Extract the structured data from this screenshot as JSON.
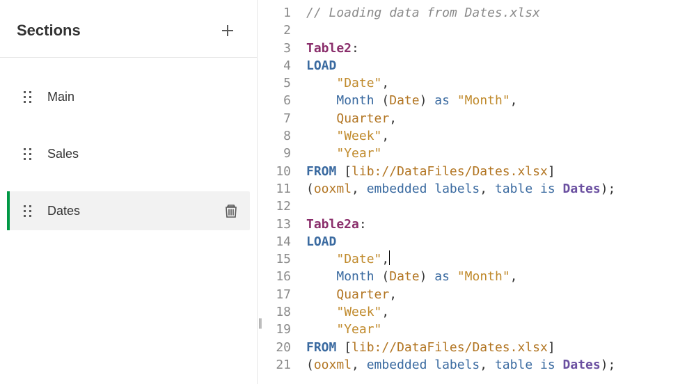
{
  "sidebar": {
    "title": "Sections",
    "items": [
      {
        "label": "Main",
        "active": false
      },
      {
        "label": "Sales",
        "active": false
      },
      {
        "label": "Dates",
        "active": true
      }
    ]
  },
  "editor": {
    "lines": [
      {
        "n": 1,
        "t": [
          {
            "c": "tok-comment",
            "v": "// Loading data from Dates.xlsx"
          }
        ]
      },
      {
        "n": 2,
        "t": []
      },
      {
        "n": 3,
        "t": [
          {
            "c": "tok-label",
            "v": "Table2"
          },
          {
            "c": "tok-plain",
            "v": ":"
          }
        ]
      },
      {
        "n": 4,
        "t": [
          {
            "c": "tok-kw",
            "v": "LOAD"
          }
        ]
      },
      {
        "n": 5,
        "t": [
          {
            "c": "tok-plain",
            "v": "    "
          },
          {
            "c": "tok-str",
            "v": "\"Date\""
          },
          {
            "c": "tok-plain",
            "v": ","
          }
        ]
      },
      {
        "n": 6,
        "t": [
          {
            "c": "tok-plain",
            "v": "    "
          },
          {
            "c": "tok-kw2",
            "v": "Month"
          },
          {
            "c": "tok-plain",
            "v": " ("
          },
          {
            "c": "tok-id",
            "v": "Date"
          },
          {
            "c": "tok-plain",
            "v": ") "
          },
          {
            "c": "tok-kw2",
            "v": "as"
          },
          {
            "c": "tok-plain",
            "v": " "
          },
          {
            "c": "tok-str",
            "v": "\"Month\""
          },
          {
            "c": "tok-plain",
            "v": ","
          }
        ]
      },
      {
        "n": 7,
        "t": [
          {
            "c": "tok-plain",
            "v": "    "
          },
          {
            "c": "tok-id",
            "v": "Quarter"
          },
          {
            "c": "tok-plain",
            "v": ","
          }
        ]
      },
      {
        "n": 8,
        "t": [
          {
            "c": "tok-plain",
            "v": "    "
          },
          {
            "c": "tok-str",
            "v": "\"Week\""
          },
          {
            "c": "tok-plain",
            "v": ","
          }
        ]
      },
      {
        "n": 9,
        "t": [
          {
            "c": "tok-plain",
            "v": "    "
          },
          {
            "c": "tok-str",
            "v": "\"Year\""
          }
        ]
      },
      {
        "n": 10,
        "t": [
          {
            "c": "tok-kw",
            "v": "FROM"
          },
          {
            "c": "tok-plain",
            "v": " ["
          },
          {
            "c": "tok-id",
            "v": "lib://DataFiles/Dates.xlsx"
          },
          {
            "c": "tok-plain",
            "v": "]"
          }
        ]
      },
      {
        "n": 11,
        "t": [
          {
            "c": "tok-plain",
            "v": "("
          },
          {
            "c": "tok-id",
            "v": "ooxml"
          },
          {
            "c": "tok-plain",
            "v": ", "
          },
          {
            "c": "tok-kw2",
            "v": "embedded labels"
          },
          {
            "c": "tok-plain",
            "v": ", "
          },
          {
            "c": "tok-kw2",
            "v": "table"
          },
          {
            "c": "tok-plain",
            "v": " "
          },
          {
            "c": "tok-kw2",
            "v": "is"
          },
          {
            "c": "tok-plain",
            "v": " "
          },
          {
            "c": "tok-kw3",
            "v": "Dates"
          },
          {
            "c": "tok-plain",
            "v": ");"
          }
        ]
      },
      {
        "n": 12,
        "t": []
      },
      {
        "n": 13,
        "t": [
          {
            "c": "tok-label",
            "v": "Table2a"
          },
          {
            "c": "tok-plain",
            "v": ":"
          }
        ]
      },
      {
        "n": 14,
        "t": [
          {
            "c": "tok-kw",
            "v": "LOAD"
          }
        ]
      },
      {
        "n": 15,
        "t": [
          {
            "c": "tok-plain",
            "v": "    "
          },
          {
            "c": "tok-str",
            "v": "\"Date\""
          },
          {
            "c": "tok-plain caret-after",
            "v": ","
          }
        ],
        "caret": true
      },
      {
        "n": 16,
        "t": [
          {
            "c": "tok-plain",
            "v": "    "
          },
          {
            "c": "tok-kw2",
            "v": "Month"
          },
          {
            "c": "tok-plain",
            "v": " ("
          },
          {
            "c": "tok-id",
            "v": "Date"
          },
          {
            "c": "tok-plain",
            "v": ") "
          },
          {
            "c": "tok-kw2",
            "v": "as"
          },
          {
            "c": "tok-plain",
            "v": " "
          },
          {
            "c": "tok-str",
            "v": "\"Month\""
          },
          {
            "c": "tok-plain",
            "v": ","
          }
        ]
      },
      {
        "n": 17,
        "t": [
          {
            "c": "tok-plain",
            "v": "    "
          },
          {
            "c": "tok-id",
            "v": "Quarter"
          },
          {
            "c": "tok-plain",
            "v": ","
          }
        ]
      },
      {
        "n": 18,
        "t": [
          {
            "c": "tok-plain",
            "v": "    "
          },
          {
            "c": "tok-str",
            "v": "\"Week\""
          },
          {
            "c": "tok-plain",
            "v": ","
          }
        ]
      },
      {
        "n": 19,
        "t": [
          {
            "c": "tok-plain",
            "v": "    "
          },
          {
            "c": "tok-str",
            "v": "\"Year\""
          }
        ]
      },
      {
        "n": 20,
        "t": [
          {
            "c": "tok-kw",
            "v": "FROM"
          },
          {
            "c": "tok-plain",
            "v": " ["
          },
          {
            "c": "tok-id",
            "v": "lib://DataFiles/Dates.xlsx"
          },
          {
            "c": "tok-plain",
            "v": "]"
          }
        ]
      },
      {
        "n": 21,
        "t": [
          {
            "c": "tok-plain",
            "v": "("
          },
          {
            "c": "tok-id",
            "v": "ooxml"
          },
          {
            "c": "tok-plain",
            "v": ", "
          },
          {
            "c": "tok-kw2",
            "v": "embedded labels"
          },
          {
            "c": "tok-plain",
            "v": ", "
          },
          {
            "c": "tok-kw2",
            "v": "table"
          },
          {
            "c": "tok-plain",
            "v": " "
          },
          {
            "c": "tok-kw2",
            "v": "is"
          },
          {
            "c": "tok-plain",
            "v": " "
          },
          {
            "c": "tok-kw3",
            "v": "Dates"
          },
          {
            "c": "tok-plain",
            "v": ");"
          }
        ]
      }
    ]
  }
}
